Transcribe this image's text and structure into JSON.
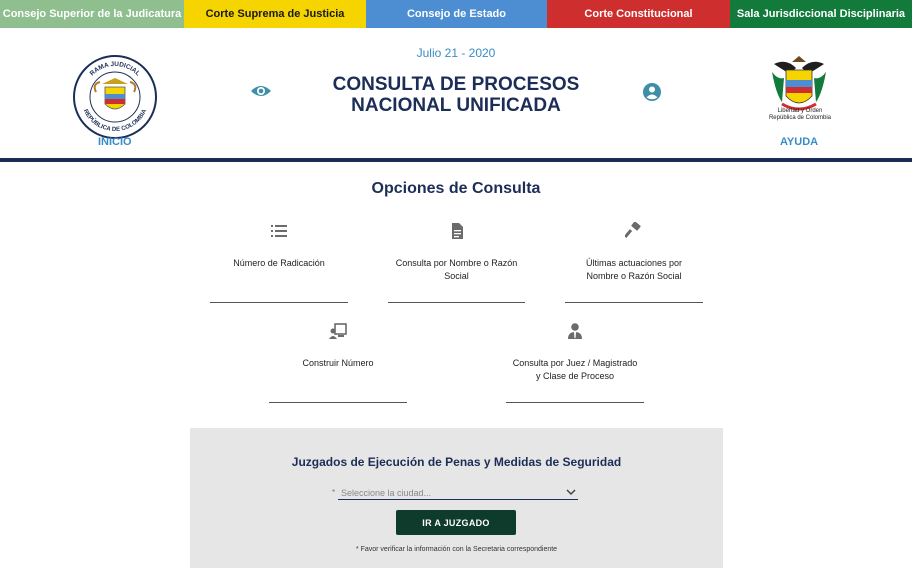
{
  "top_nav": [
    {
      "label": "Consejo Superior de la Judicatura"
    },
    {
      "label": "Corte Suprema de Justicia"
    },
    {
      "label": "Consejo de Estado"
    },
    {
      "label": "Corte Constitucional"
    },
    {
      "label": "Sala Jurisdiccional Disciplinaria"
    }
  ],
  "header": {
    "date": "Julio 21 - 2020",
    "title_line1": "CONSULTA DE PROCESOS",
    "title_line2": "NACIONAL UNIFICADA",
    "inicio_label": "INICIO",
    "ayuda_label": "AYUDA",
    "left_logo_text_top": "RAMA JUDICIAL",
    "left_logo_text_bottom": "REPÚBLICA DE COLOMBIA",
    "right_logo_caption_line1": "Libertad y Orden",
    "right_logo_caption_line2": "República de Colombia",
    "eye_icon": "eye-icon",
    "user_icon": "user-circle-icon"
  },
  "options": {
    "title": "Opciones de Consulta",
    "items": [
      {
        "icon": "list-icon",
        "line1": "Número de Radicación",
        "line2": ""
      },
      {
        "icon": "document-icon",
        "line1": "Consulta por Nombre o Razón",
        "line2": "Social"
      },
      {
        "icon": "gavel-icon",
        "line1": "Últimas actuaciones por",
        "line2": "Nombre o Razón Social"
      },
      {
        "icon": "construct-number-icon",
        "line1": "Construir Número",
        "line2": ""
      },
      {
        "icon": "judge-icon",
        "line1": "Consulta por Juez / Magistrado",
        "line2": "y Clase de Proceso"
      }
    ]
  },
  "panel": {
    "title": "Juzgados de Ejecución de Penas y Medidas de Seguridad",
    "required_mark": "*",
    "select_placeholder": "Seleccione la ciudad...",
    "button_label": "IR A JUZGADO",
    "note": "* Favor verificar la información con la Secretaria correspondiente"
  },
  "colors": {
    "navy": "#1c2e57",
    "link_blue": "#3a8bc6",
    "icon_teal": "#3d8fa8",
    "button_green": "#0e3b2c"
  }
}
